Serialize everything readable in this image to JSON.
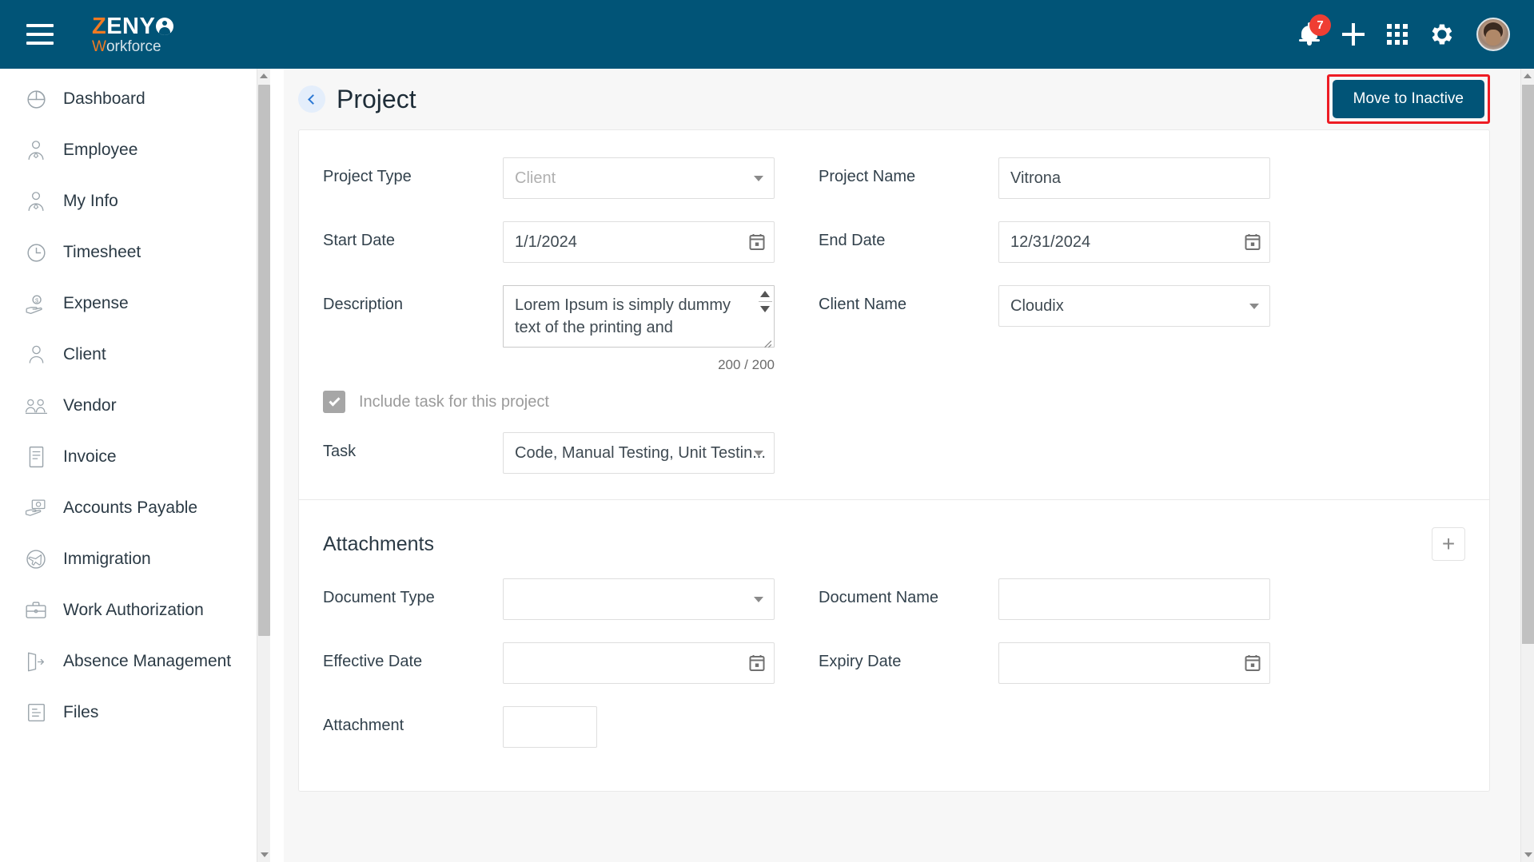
{
  "topbar": {
    "menu_icon": "hamburger-icon",
    "logo": {
      "part1": "Z",
      "part2": "ENY",
      "part3": "W",
      "part4": "orkforce"
    },
    "notification_count": "7",
    "icons": [
      "bell-icon",
      "plus-icon",
      "apps-grid-icon",
      "gear-icon",
      "avatar"
    ],
    "brand_color": "#015477",
    "accent_color": "#f07a22",
    "badge_color": "#ef3e33"
  },
  "sidebar": {
    "items": [
      {
        "label": "Dashboard",
        "icon": "pie-chart-icon"
      },
      {
        "label": "Employee",
        "icon": "employee-icon"
      },
      {
        "label": "My Info",
        "icon": "my-info-icon"
      },
      {
        "label": "Timesheet",
        "icon": "clock-icon"
      },
      {
        "label": "Expense",
        "icon": "expense-icon"
      },
      {
        "label": "Client",
        "icon": "person-icon"
      },
      {
        "label": "Vendor",
        "icon": "vendor-icon"
      },
      {
        "label": "Invoice",
        "icon": "invoice-icon"
      },
      {
        "label": "Accounts Payable",
        "icon": "accounts-payable-icon"
      },
      {
        "label": "Immigration",
        "icon": "airplane-globe-icon"
      },
      {
        "label": "Work Authorization",
        "icon": "briefcase-icon"
      },
      {
        "label": "Absence Management",
        "icon": "exit-door-icon"
      },
      {
        "label": "Files",
        "icon": "files-icon"
      }
    ]
  },
  "page": {
    "title": "Project",
    "back_icon": "chevron-left-icon",
    "action_button": "Move to Inactive",
    "highlight_color": "#ee1c24"
  },
  "project_form": {
    "project_type": {
      "label": "Project Type",
      "value": "Client"
    },
    "project_name": {
      "label": "Project Name",
      "value": "Vitrona"
    },
    "start_date": {
      "label": "Start Date",
      "value": "1/1/2024"
    },
    "end_date": {
      "label": "End Date",
      "value": "12/31/2024"
    },
    "description": {
      "label": "Description",
      "value": "Lorem Ipsum is simply dummy text of the printing and",
      "counter": "200 / 200"
    },
    "client_name": {
      "label": "Client Name",
      "value": "Cloudix"
    },
    "include_task": {
      "label": "Include task for this project",
      "checked": true
    },
    "task": {
      "label": "Task",
      "value": "Code, Manual Testing, Unit Testin..."
    }
  },
  "attachments": {
    "title": "Attachments",
    "add_button": "+",
    "document_type": {
      "label": "Document Type",
      "value": ""
    },
    "document_name": {
      "label": "Document Name",
      "value": ""
    },
    "effective_date": {
      "label": "Effective Date",
      "value": ""
    },
    "expiry_date": {
      "label": "Expiry Date",
      "value": ""
    },
    "attachment": {
      "label": "Attachment",
      "value": ""
    }
  }
}
